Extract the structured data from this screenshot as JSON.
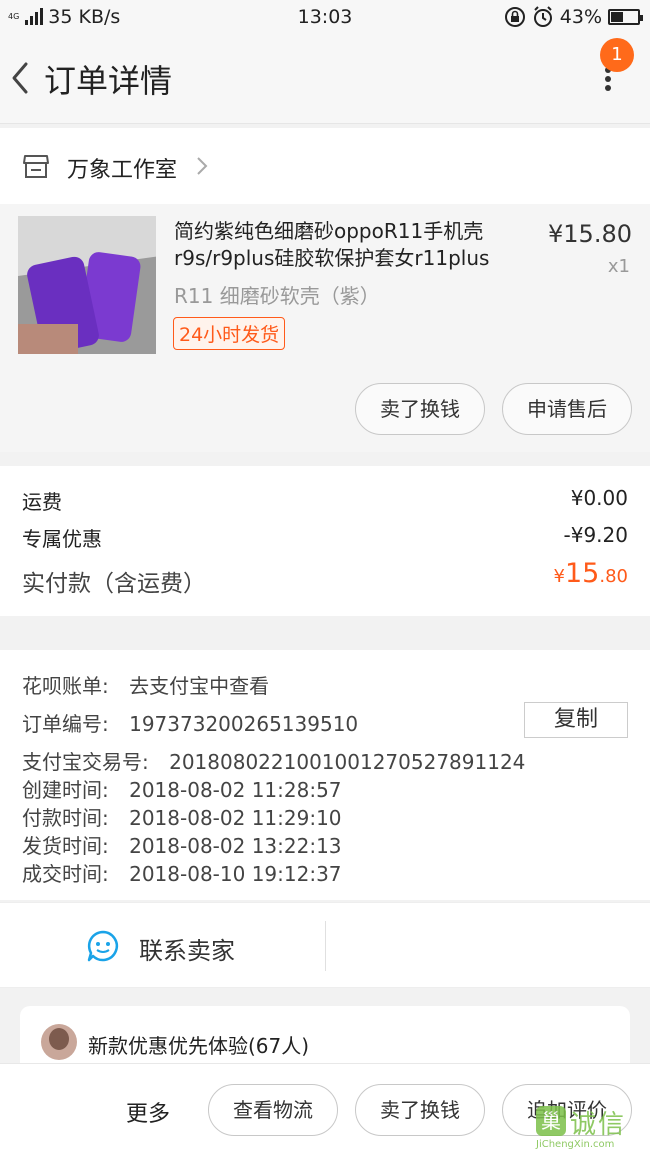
{
  "status_bar": {
    "network": "4G",
    "speed": "35 KB/s",
    "time": "13:03",
    "battery": "43%",
    "battery_level": 0.43
  },
  "header": {
    "title": "订单详情",
    "notification_count": "1"
  },
  "store": {
    "name": "万象工作室"
  },
  "product": {
    "title": "简约紫纯色细磨砂oppoR11手机壳r9s/r9plus硅胶软保护套女r11plus",
    "sku": "R11 细磨砂软壳（紫）",
    "tag": "24小时发货",
    "price": "¥15.80",
    "quantity": "x1",
    "actions": {
      "sell": "卖了换钱",
      "after_sale": "申请售后"
    }
  },
  "cost": {
    "shipping_label": "运费",
    "shipping_value": "¥0.00",
    "discount_label": "专属优惠",
    "discount_value": "-¥9.20",
    "paid_label": "实付款（含运费）",
    "paid_currency": "¥",
    "paid_int": "15",
    "paid_dec": ".80"
  },
  "info": {
    "huabei_label": "花呗账单:",
    "huabei_value": "去支付宝中查看",
    "order_no_label": "订单编号:",
    "order_no_value": "197373200265139510",
    "copy_label": "复制",
    "alipay_label": "支付宝交易号:",
    "alipay_value": "2018080221001001270527891124",
    "created_label": "创建时间:",
    "created_value": "2018-08-02 11:28:57",
    "paid_label": "付款时间:",
    "paid_value": "2018-08-02 11:29:10",
    "shipped_label": "发货时间:",
    "shipped_value": "2018-08-02 13:22:13",
    "closed_label": "成交时间:",
    "closed_value": "2018-08-10 19:12:37"
  },
  "contact": {
    "label": "联系卖家"
  },
  "promo": {
    "text": "新款优惠优先体验(67人)"
  },
  "bottom_bar": {
    "more": "更多",
    "logistics": "查看物流",
    "sell": "卖了换钱",
    "review": "追加评价"
  },
  "watermark": {
    "mark": "巢",
    "name": "诚信",
    "url": "JiChengXin.com"
  },
  "colors": {
    "accent": "#ff5a1a",
    "badge": "#ff6a1a",
    "contact_icon": "#1aa3e8"
  }
}
